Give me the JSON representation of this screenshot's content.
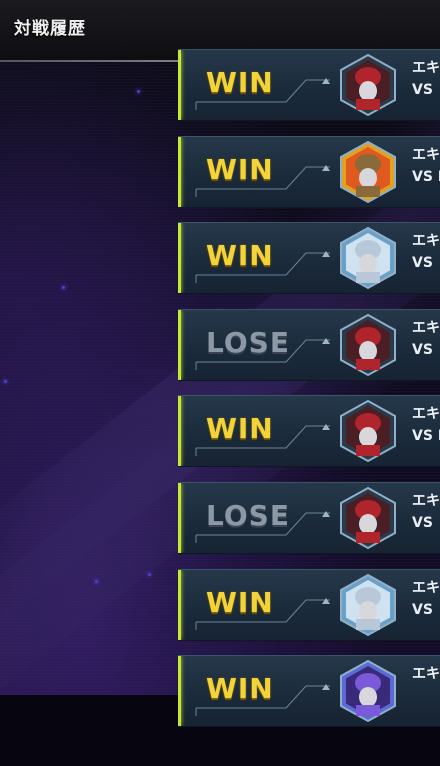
{
  "header": {
    "title": "対戦履歴"
  },
  "matches": [
    {
      "result": "WIN",
      "type": "win",
      "avatar": "red-cap-duelist-icon",
      "player": "エキ",
      "vs": "VS ",
      "avatar_colors": {
        "rim": "#2a3a4a",
        "bg": "#4a1e24",
        "main": "#b0242c"
      }
    },
    {
      "result": "WIN",
      "type": "win",
      "avatar": "kuriboh-monster-icon",
      "player": "エキ",
      "vs": "VS I",
      "avatar_colors": {
        "rim": "#e0a020",
        "bg": "#e05a20",
        "main": "#8a6a3a"
      }
    },
    {
      "result": "WIN",
      "type": "win",
      "avatar": "silver-hair-duelist-icon",
      "player": "エキ",
      "vs": "VS ",
      "avatar_colors": {
        "rim": "#6aa0c8",
        "bg": "#cfe2ef",
        "main": "#b9c8d8"
      }
    },
    {
      "result": "LOSE",
      "type": "lose",
      "avatar": "red-cap-duelist-icon",
      "player": "エキ",
      "vs": "VS ",
      "avatar_colors": {
        "rim": "#2a3a4a",
        "bg": "#4a1e24",
        "main": "#b0242c"
      }
    },
    {
      "result": "WIN",
      "type": "win",
      "avatar": "red-cap-duelist-icon",
      "player": "エキ",
      "vs": "VS I",
      "avatar_colors": {
        "rim": "#2a3a4a",
        "bg": "#4a1e24",
        "main": "#b0242c"
      }
    },
    {
      "result": "LOSE",
      "type": "lose",
      "avatar": "red-cap-duelist-icon",
      "player": "エキ",
      "vs": "VS ",
      "avatar_colors": {
        "rim": "#2a3a4a",
        "bg": "#4a1e24",
        "main": "#b0242c"
      }
    },
    {
      "result": "WIN",
      "type": "win",
      "avatar": "silver-hair-duelist-icon",
      "player": "エキ",
      "vs": "VS ",
      "avatar_colors": {
        "rim": "#6aa0c8",
        "bg": "#cfe2ef",
        "main": "#b9c8d8"
      }
    },
    {
      "result": "WIN",
      "type": "win",
      "avatar": "purple-hair-duelist-icon",
      "player": "エキ",
      "vs": "",
      "avatar_colors": {
        "rim": "#5a6ad8",
        "bg": "#3a2a7a",
        "main": "#7a5ad8"
      }
    }
  ],
  "colors": {
    "win": "#f2d33a",
    "lose": "#8c98a6",
    "edge": "#c6e832"
  }
}
